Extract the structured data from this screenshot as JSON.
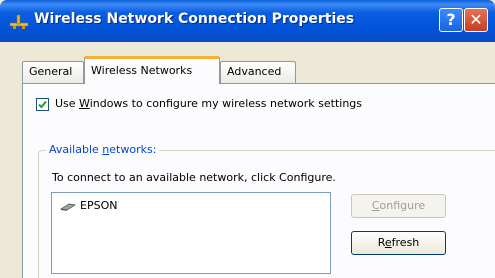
{
  "window": {
    "title": "Wireless Network Connection Properties",
    "help_label": "?",
    "close_label": "✕"
  },
  "tabs": [
    {
      "label": "General",
      "selected": false
    },
    {
      "label": "Wireless Networks",
      "selected": true
    },
    {
      "label": "Advanced",
      "selected": false
    }
  ],
  "checkbox": {
    "checked": true,
    "label_pre": "Use ",
    "label_key": "W",
    "label_post": "indows to configure my wireless network settings"
  },
  "available": {
    "group_pre": "Available ",
    "group_key": "n",
    "group_post": "etworks:",
    "hint": "To connect to an available network, click Configure.",
    "networks": [
      {
        "name": "EPSON"
      }
    ]
  },
  "buttons": {
    "configure": {
      "key": "C",
      "rest": "onfigure",
      "enabled": false
    },
    "refresh": {
      "pre": "R",
      "key": "e",
      "rest": "fresh",
      "enabled": true
    }
  },
  "colors": {
    "title_bar": "#0053d8",
    "tab_highlight": "#f8b038",
    "group_label": "#0046d5",
    "face": "#ece9d8"
  },
  "icons": {
    "title": "wireless-network-icon",
    "network": "ad-hoc-network-icon"
  }
}
